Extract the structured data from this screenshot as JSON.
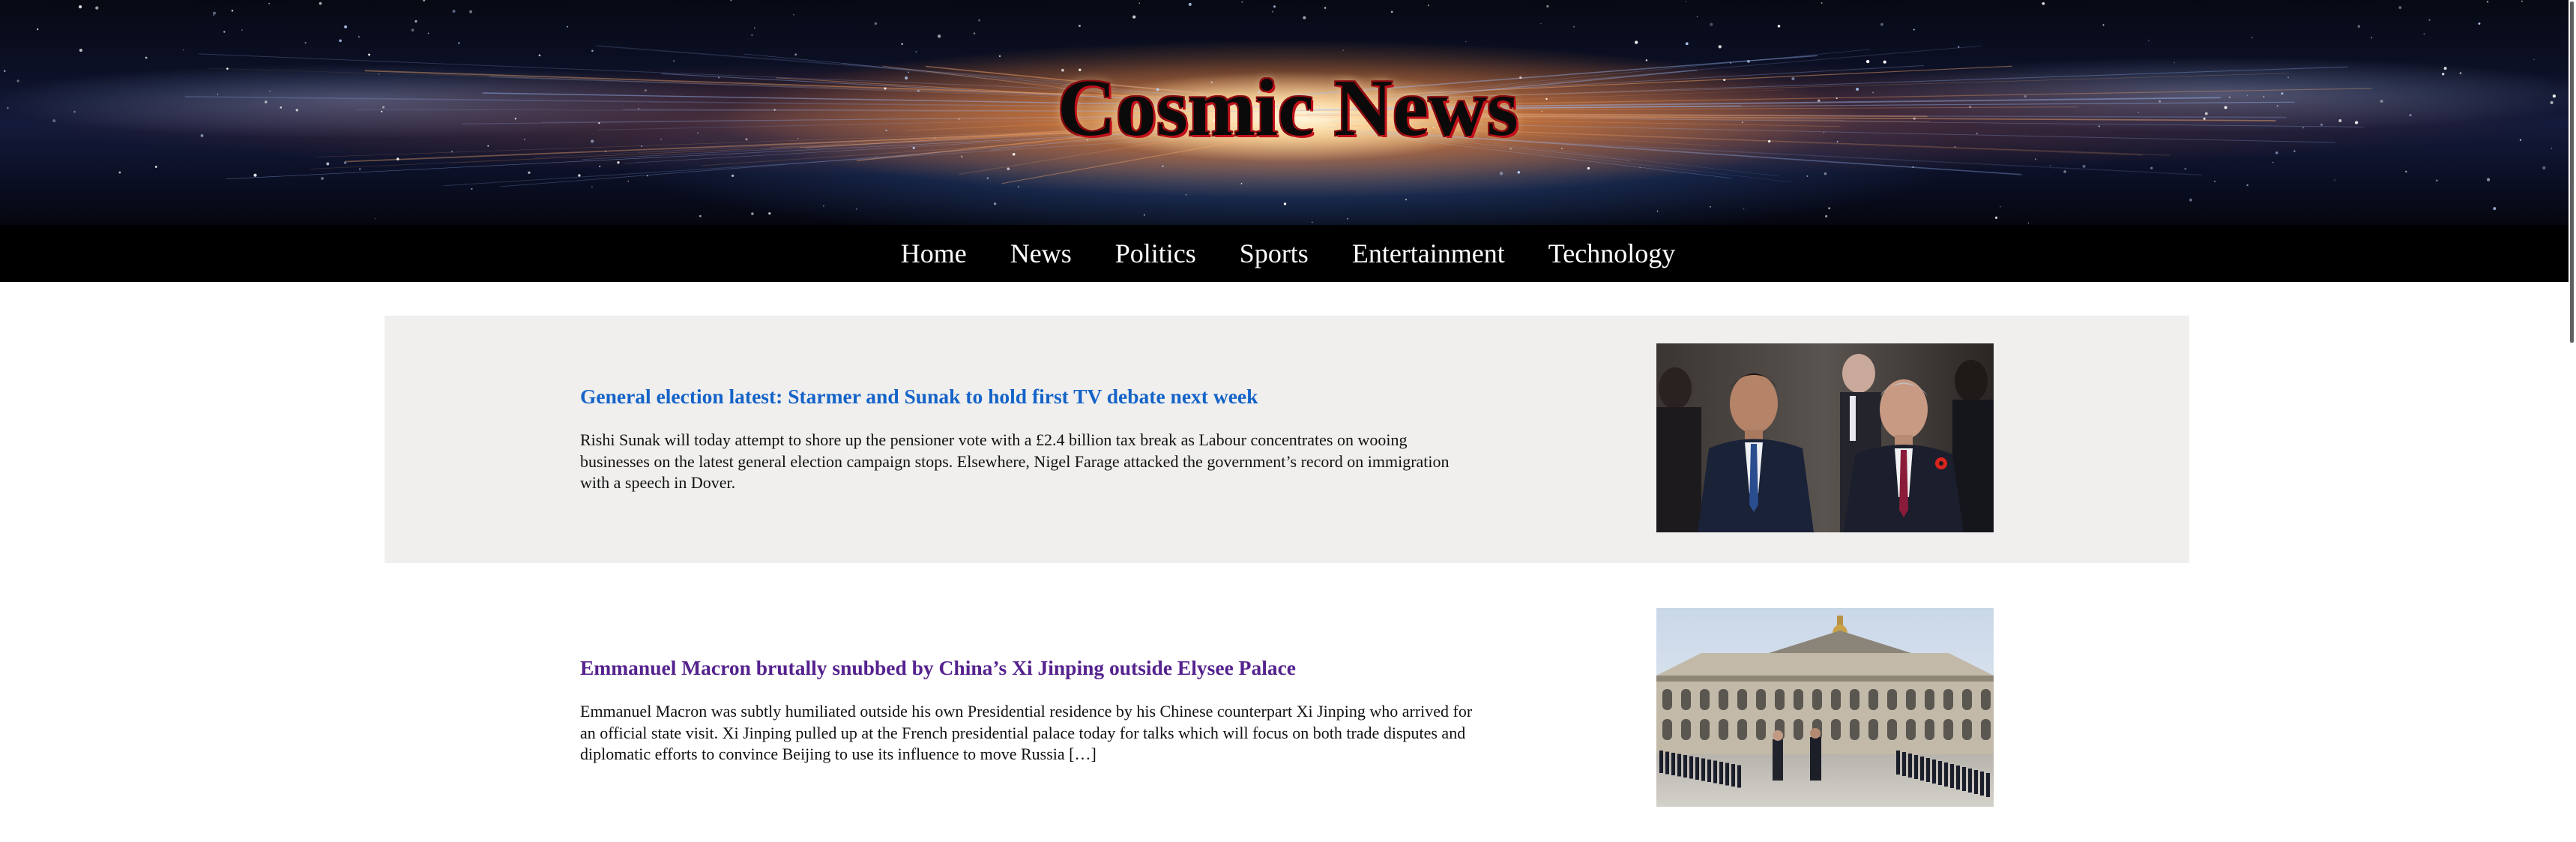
{
  "site": {
    "title": "Cosmic News"
  },
  "nav": {
    "items": [
      {
        "label": "Home"
      },
      {
        "label": "News"
      },
      {
        "label": "Politics"
      },
      {
        "label": "Sports"
      },
      {
        "label": "Entertainment"
      },
      {
        "label": "Technology"
      }
    ]
  },
  "articles": [
    {
      "headline": "General election latest: Starmer and Sunak to hold first TV debate next week",
      "summary": "Rishi Sunak will today attempt to shore up the pensioner vote with a £2.4 billion tax break as Labour concentrates on wooing businesses on the latest general election campaign stops. Elsewhere, Nigel Farage attacked the government’s record on immigration with a speech in Dover.",
      "link_state": "unvisited",
      "image": "photo of two politicians in suits",
      "link_color": "#1463c8"
    },
    {
      "headline": "Emmanuel Macron brutally snubbed by China’s Xi Jinping outside Elysee Palace",
      "summary": "Emmanuel Macron was subtly humiliated outside his own Presidential residence by his Chinese counterpart Xi Jinping who arrived for an official state visit. Xi Jinping pulled up at the French presidential palace today for talks which will focus on both trade disputes and diplomatic efforts to convince Beijing to use its influence to move Russia […]",
      "link_state": "visited",
      "image": "photo of leaders walking in palace courtyard with honor guard",
      "link_color": "#55228e"
    }
  ],
  "colors": {
    "nav_background": "#000000",
    "article_shade": "#f0efee",
    "title_outline": "#c0101a"
  }
}
